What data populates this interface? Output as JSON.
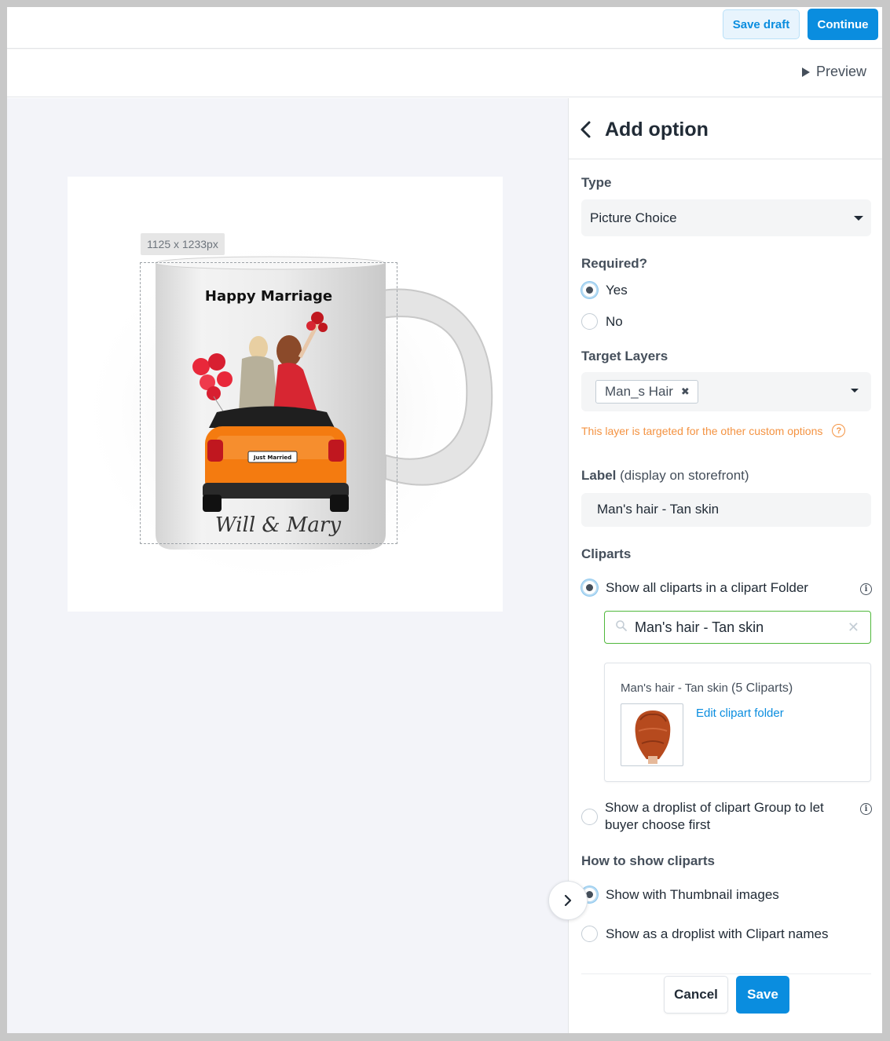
{
  "toolbar": {
    "save_draft_label": "Save draft",
    "continue_label": "Continue"
  },
  "preview": {
    "label": "Preview"
  },
  "canvas": {
    "size_tag": "1125 x 1233px",
    "mug_text_top": "Happy Marriage",
    "mug_text_bottom": "Will & Mary",
    "plate_text": "Just Married"
  },
  "panel": {
    "title": "Add option",
    "type": {
      "label": "Type",
      "value": "Picture Choice"
    },
    "required": {
      "label": "Required?",
      "options": [
        "Yes",
        "No"
      ],
      "selected": "Yes"
    },
    "target_layers": {
      "label": "Target Layers",
      "chip": "Man_s Hair",
      "warning": "This layer is targeted for the other custom options"
    },
    "label_field": {
      "label": "Label",
      "hint": "(display on storefront)",
      "value": "Man's hair - Tan skin"
    },
    "cliparts": {
      "label": "Cliparts",
      "option_folder": "Show all cliparts in a clipart Folder",
      "search_value": "Man's hair - Tan skin",
      "folder_name": "Man's hair - Tan skin",
      "folder_count": "(5 Cliparts)",
      "edit_link": "Edit clipart folder",
      "option_group": "Show a droplist of clipart Group to let buyer choose first"
    },
    "how_to_show": {
      "label": "How to show cliparts",
      "option_thumbnails": "Show with Thumbnail images",
      "option_droplist": "Show as a droplist with Clipart names"
    },
    "cancel_label": "Cancel",
    "save_label": "Save"
  },
  "colors": {
    "accent": "#0a8ddf",
    "warning": "#f49342",
    "success_border": "#50b83c"
  }
}
